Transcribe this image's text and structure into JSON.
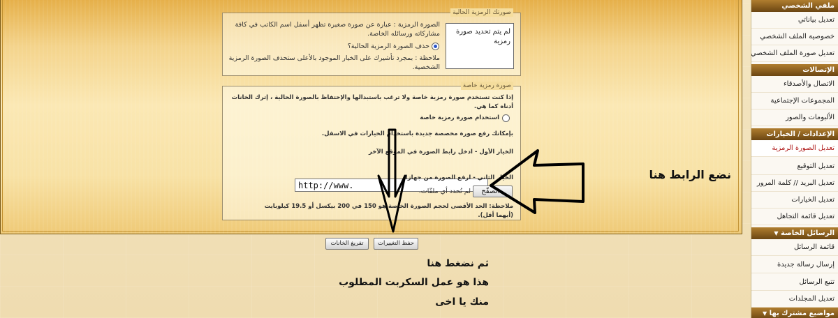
{
  "current_avatar": {
    "legend": "صورتك الرمزية الحالية",
    "description": "الصورة الرمزية : عبارة عن صورة صغيرة تظهر أسفل اسم الكاتب في كافة مشاركاته ورسائله الخاصة.",
    "no_avatar_text": "لم يتم تحديد صورة رمزية",
    "delete_option": "حذف الصورة الرمزية الحالية؟",
    "note": "ملاحظة : بمجرد تأشيرك على الخيار الموجود بالأعلى ستحذف الصورة الرمزية الشخصية."
  },
  "custom_avatar": {
    "legend": "صورة رمزية خاصة",
    "intro": "إذا كنت تستخدم صورة رمزية خاصة ولا ترغب باستبدالها والإحتفاظ بالصورة الحالية ، إترك الخانات أدناه كما هي.",
    "use_custom_option": "استخدام صورة رمزية خاصة",
    "upload_hint": "بإمكانك رفع صورة مخصصة جديدة باستخدام الخيارات في الاسفل.",
    "option1_label": "الخيار الأول - ادخل رابط الصورة في الموقع الآخر",
    "url_value": "http://www.",
    "option2_label": "الخيار الثاني - ارفع الصورة من جهازك",
    "browse_label": "تصفّح...",
    "no_file_text": "لم تُحدد أي ملفّات.",
    "size_note": "ملاحظة: الحد الأقصى لحجم الصورة الخاصة هو 150 في 200 بيكسل أو 19.5 كيلوبايت (أيهما أقل)."
  },
  "actions": {
    "save_label": "حفظ التغييرات",
    "reset_label": "تفريغ الخانات"
  },
  "annotations": {
    "put_link_here": "نضع الرابط هنا",
    "line1": "ثم نضغط هنا",
    "line2": "هذا هو عمل السكربت المطلوب",
    "line3": "منك يا اخى"
  },
  "sidebar": {
    "sections": [
      {
        "header": "ملفي الشخصي",
        "items": [
          "تعديل بياناتي",
          "خصوصية الملف الشخصي",
          "تعديل صورة الملف الشخصي"
        ]
      },
      {
        "header": "الإتصالات",
        "items": [
          "الاتصال والأصدقاء",
          "المجموعات الإجتماعية",
          "الألبومات والصور"
        ]
      },
      {
        "header": "الإعدادات / الخيارات",
        "items": [
          "تعديل الصورة الرمزية",
          "تعديل التوقيع",
          "تعديل البريد // كلمة المرور",
          "تعديل الخيارات",
          "تعديل قائمة التجاهل"
        ]
      },
      {
        "header": "الرسائل الخاصة",
        "items": [
          "قائمة الرسائل",
          "إرسال رسالة جديدة",
          "تتبع الرسائل",
          "تعديل المجلدات"
        ]
      },
      {
        "header": "مواضيع مشترك بها",
        "items": []
      }
    ],
    "active_item": "تعديل الصورة الرمزية"
  },
  "colors": {
    "panel_gold": "#f4d48c",
    "sidebar_header": "#8a5a1e",
    "active_link": "#b01c1c"
  }
}
